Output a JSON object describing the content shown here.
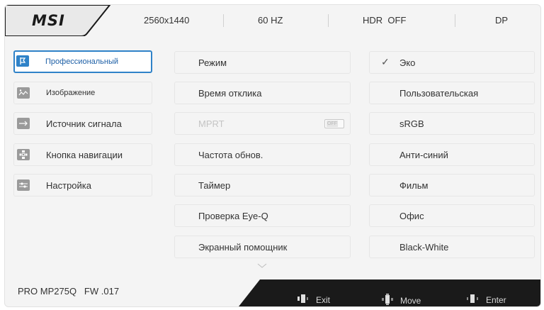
{
  "header": {
    "logo": "MSI",
    "resolution": "2560x1440",
    "refresh": "60 HZ",
    "hdr": "HDR  OFF",
    "input": "DP"
  },
  "menu": [
    {
      "label": "Профессиональный",
      "icon": "flag-icon",
      "active": true
    },
    {
      "label": "Изображение",
      "icon": "image-icon"
    },
    {
      "label": "Источник сигнала",
      "icon": "arrow-right-icon"
    },
    {
      "label": "Кнопка навигации",
      "icon": "navigation-icon"
    },
    {
      "label": "Настройка",
      "icon": "settings-sliders-icon"
    }
  ],
  "options": [
    {
      "label": "Режим"
    },
    {
      "label": "Время отклика"
    },
    {
      "label": "MPRT",
      "disabled": true,
      "toggle": "OFF"
    },
    {
      "label": "Частота обнов."
    },
    {
      "label": "Таймер"
    },
    {
      "label": "Проверка Eye-Q"
    },
    {
      "label": "Экранный помощник"
    }
  ],
  "modes": [
    {
      "label": "Эко",
      "checked": true
    },
    {
      "label": "Пользовательская"
    },
    {
      "label": "sRGB"
    },
    {
      "label": "Анти-синий"
    },
    {
      "label": "Фильм"
    },
    {
      "label": "Офис"
    },
    {
      "label": "Black-White"
    }
  ],
  "footer": {
    "model": "PRO MP275Q   FW .017",
    "exit": "Exit",
    "move": "Move",
    "enter": "Enter"
  },
  "colors": {
    "accent": "#2f82c8",
    "footer": "#1a1a1a"
  }
}
